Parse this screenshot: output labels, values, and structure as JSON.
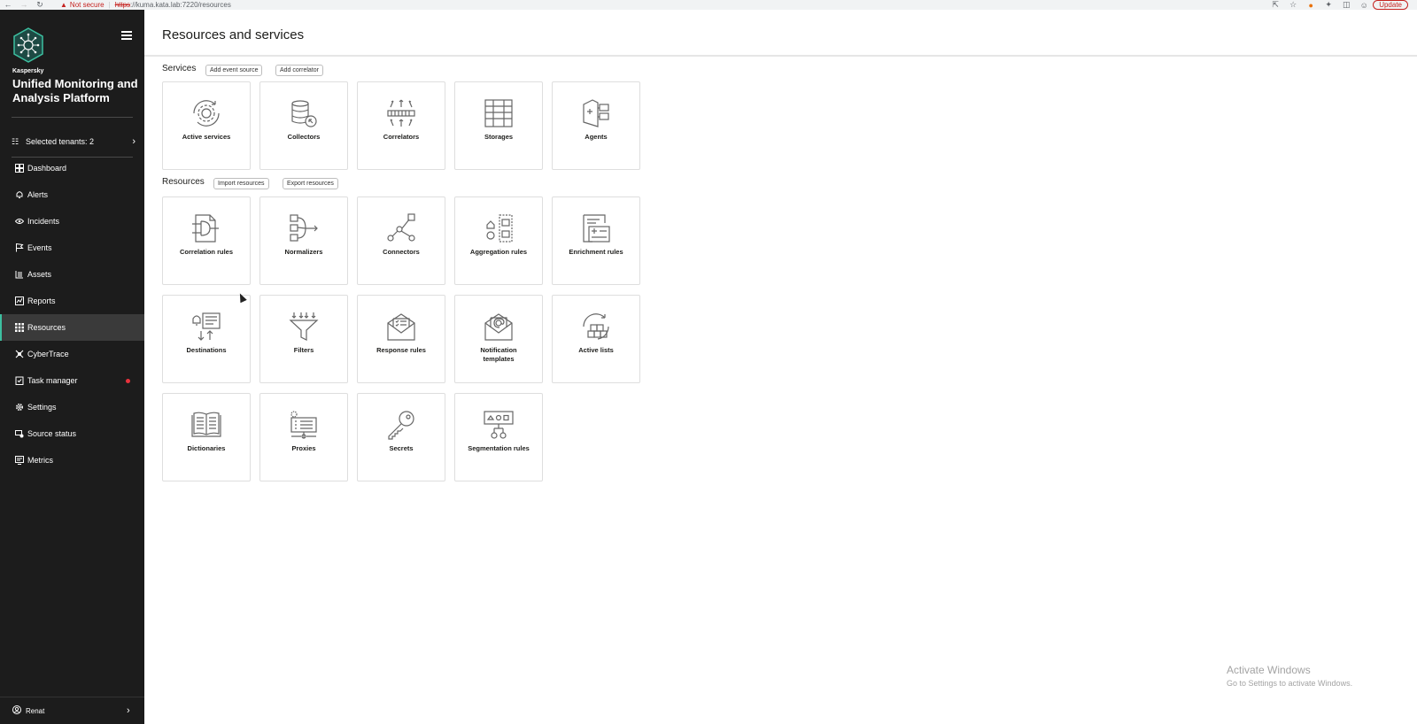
{
  "browser": {
    "not_secure": "Not secure",
    "url_scheme": "https",
    "url_rest": "://kuma.kata.lab:7220/resources",
    "update_label": "Update"
  },
  "sidebar": {
    "brand_small": "Kaspersky",
    "brand_title": "Unified Monitoring and Analysis Platform",
    "tenants_label": "Selected tenants: 2",
    "items": [
      {
        "label": "Dashboard",
        "icon": "dashboard-icon"
      },
      {
        "label": "Alerts",
        "icon": "bell-icon"
      },
      {
        "label": "Incidents",
        "icon": "eye-icon"
      },
      {
        "label": "Events",
        "icon": "flag-icon"
      },
      {
        "label": "Assets",
        "icon": "assets-icon"
      },
      {
        "label": "Reports",
        "icon": "reports-icon"
      },
      {
        "label": "Resources",
        "icon": "grid-icon"
      },
      {
        "label": "CyberTrace",
        "icon": "cybertrace-icon"
      },
      {
        "label": "Task manager",
        "icon": "task-icon"
      },
      {
        "label": "Settings",
        "icon": "gear-icon"
      },
      {
        "label": "Source status",
        "icon": "source-status-icon"
      },
      {
        "label": "Metrics",
        "icon": "metrics-icon"
      }
    ],
    "active_item": "Resources",
    "user_name": "Renat"
  },
  "main": {
    "title": "Resources and services",
    "services": {
      "label": "Services",
      "buttons": [
        "Add event source",
        "Add correlator"
      ],
      "tiles": [
        {
          "label": "Active services",
          "icon": "gear-cycle-icon"
        },
        {
          "label": "Collectors",
          "icon": "database-icon"
        },
        {
          "label": "Correlators",
          "icon": "correlator-icon"
        },
        {
          "label": "Storages",
          "icon": "storage-icon"
        },
        {
          "label": "Agents",
          "icon": "agent-icon"
        }
      ]
    },
    "resources": {
      "label": "Resources",
      "buttons": [
        "Import resources",
        "Export resources"
      ],
      "tiles": [
        {
          "label": "Correlation rules",
          "icon": "correlation-rules-icon"
        },
        {
          "label": "Normalizers",
          "icon": "normalizer-icon"
        },
        {
          "label": "Connectors",
          "icon": "connector-icon"
        },
        {
          "label": "Aggregation rules",
          "icon": "aggregation-icon"
        },
        {
          "label": "Enrichment rules",
          "icon": "enrichment-icon"
        },
        {
          "label": "Destinations",
          "icon": "destination-icon"
        },
        {
          "label": "Filters",
          "icon": "filter-icon"
        },
        {
          "label": "Response rules",
          "icon": "response-icon"
        },
        {
          "label": "Notification templates",
          "icon": "notification-icon"
        },
        {
          "label": "Active lists",
          "icon": "active-list-icon"
        },
        {
          "label": "Dictionaries",
          "icon": "book-icon"
        },
        {
          "label": "Proxies",
          "icon": "proxy-icon"
        },
        {
          "label": "Secrets",
          "icon": "key-icon"
        },
        {
          "label": "Segmentation rules",
          "icon": "segmentation-icon"
        }
      ]
    }
  },
  "watermark": {
    "line1": "Activate Windows",
    "line2": "Go to Settings to activate Windows."
  }
}
